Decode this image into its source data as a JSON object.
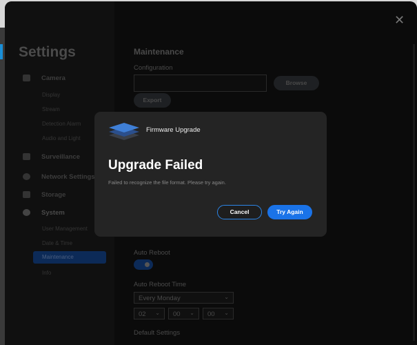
{
  "sidebar": {
    "title": "Settings",
    "groups": [
      {
        "label": "Camera",
        "icon": "camera-icon",
        "items": [
          "Display",
          "Stream",
          "Detection Alarm",
          "Audio and Light"
        ]
      },
      {
        "label": "Surveillance",
        "icon": "monitor-icon"
      },
      {
        "label": "Network Settings",
        "icon": "globe-icon"
      },
      {
        "label": "Storage",
        "icon": "storage-icon"
      },
      {
        "label": "System",
        "icon": "gear-icon",
        "items": [
          "User Management",
          "Date & Time",
          "Maintenance",
          "Info"
        ]
      }
    ],
    "selected": "Maintenance"
  },
  "main": {
    "heading": "Maintenance",
    "configuration_label": "Configuration",
    "browse": "Browse",
    "export": "Export",
    "auto_reboot_label": "Auto Reboot",
    "auto_reboot_on": true,
    "auto_reboot_time_label": "Auto Reboot Time",
    "day": "Every Monday",
    "hour": "02",
    "minute": "00",
    "second": "00",
    "default_settings_label": "Default Settings"
  },
  "dialog": {
    "title": "Firmware Upgrade",
    "heading": "Upgrade Failed",
    "message": "Failed to recognize the file format. Please try again.",
    "cancel": "Cancel",
    "retry": "Try Again",
    "accent": "#1a73e8"
  }
}
